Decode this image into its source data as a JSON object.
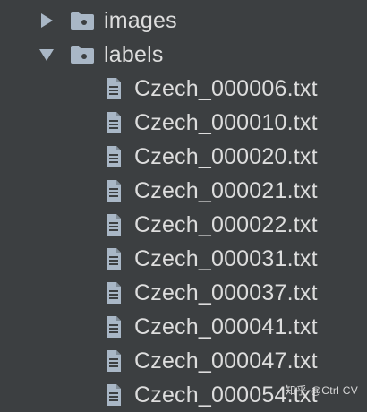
{
  "tree": {
    "folders": [
      {
        "name": "images",
        "expanded": false
      },
      {
        "name": "labels",
        "expanded": true
      }
    ],
    "files": [
      "Czech_000006.txt",
      "Czech_000010.txt",
      "Czech_000020.txt",
      "Czech_000021.txt",
      "Czech_000022.txt",
      "Czech_000031.txt",
      "Czech_000037.txt",
      "Czech_000041.txt",
      "Czech_000047.txt",
      "Czech_000054.txt"
    ]
  },
  "icons": {
    "collapsed_arrow": "triangle-right-icon",
    "expanded_arrow": "triangle-down-icon",
    "folder": "folder-icon",
    "file": "text-file-icon"
  },
  "colors": {
    "background": "#3c3f41",
    "text": "#dddddd",
    "icon": "#a9b7c6"
  },
  "watermark": "知乎 @Ctrl CV"
}
